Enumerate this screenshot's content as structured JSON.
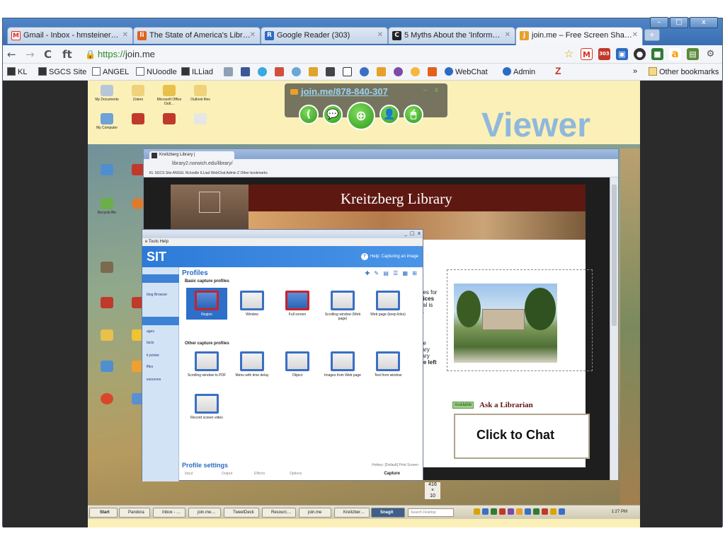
{
  "window": {
    "min": "–",
    "max": "□",
    "close": "x",
    "tabs": [
      {
        "label": "Gmail - Inbox - hmsteiner…",
        "favicon": "M",
        "color": "#d93025"
      },
      {
        "label": "The State of America's Libr…",
        "favicon": "li",
        "color": "#e0601c"
      },
      {
        "label": "Google Reader (303)",
        "favicon": "R",
        "color": "#2b6bc4"
      },
      {
        "label": "5 Myths About the 'Inform…",
        "favicon": "C",
        "color": "#222222"
      },
      {
        "label": "join.me – Free Screen Sha…",
        "favicon": "j",
        "color": "#e9a02a"
      }
    ],
    "new_tab": "+"
  },
  "toolbar": {
    "back": "←",
    "forward": "→",
    "reload": "C",
    "home": "ft",
    "url_scheme": "https://",
    "url_rest": "join.me"
  },
  "extensions": [
    {
      "name": "star-icon",
      "glyph": "☆",
      "color": "#d9a400"
    },
    {
      "name": "gmail-icon",
      "glyph": "M",
      "color": "#d93025"
    },
    {
      "name": "reader-count-icon",
      "glyph": "303",
      "color": "#c0392b"
    },
    {
      "name": "photo-icon",
      "glyph": "▣",
      "color": "#2b6bc4"
    },
    {
      "name": "circle-icon",
      "glyph": "●",
      "color": "#333333"
    },
    {
      "name": "puzzle-icon",
      "glyph": "■",
      "color": "#2e7d32"
    },
    {
      "name": "amazon-icon",
      "glyph": "a",
      "color": "#ff9900"
    },
    {
      "name": "page-icon",
      "glyph": "▤",
      "color": "#5a8a3a"
    },
    {
      "name": "wrench-icon",
      "glyph": "🔧",
      "color": "#666666"
    }
  ],
  "bookmarks": {
    "kl": "KL",
    "sgcs": "SGCS Site",
    "angel": "ANGEL",
    "nuoodle": "NUoodle",
    "illiad": "ILLiad",
    "webchat": "WebChat",
    "admin": "Admin",
    "z": "Z",
    "overflow": "»",
    "other": "Other bookmarks"
  },
  "joinme": {
    "url": "join.me/878-840-307",
    "min": "–",
    "close": "x",
    "buttons": [
      "(",
      "💬",
      "⊕",
      "👤",
      "🖱"
    ]
  },
  "viewer_label": "Viewer",
  "inner_browser": {
    "tab_label": "Kreitzberg Library |",
    "url": "library2.norwich.edu/library/",
    "bookmarks": "KL   SGCS Site   ANGEL   NUoodle   ILLiad        WebChat   Admin   Z          Other bookmarks"
  },
  "library": {
    "title": "Kreitzberg Library",
    "text_lines": [
      "oes for",
      "vices",
      "ital is",
      "s.",
      "",
      "",
      "ne",
      "rary",
      "rary",
      "he left"
    ],
    "available": "Available",
    "ask": "Ask a Librarian",
    "chat": "Click to Chat"
  },
  "snagit": {
    "winbtns": "_ □ x",
    "menu": "e   Tools   Help",
    "brand": "SIT",
    "help": "Help: Capturing an image",
    "profiles": "Profiles",
    "basic_header": "Basic capture profiles",
    "other_header": "Other capture profiles",
    "basic": [
      "Region",
      "Window",
      "Full screen",
      "Scrolling window (Web page)",
      "Web page (keep links)"
    ],
    "other": [
      "Scrolling window to PDF",
      "Menu with time delay",
      "Object",
      "Images from Web page",
      "Text from window"
    ],
    "record": "Record screen video",
    "side_items": [
      "blog Browser",
      "ages",
      "facts",
      "ti printer",
      "ffles",
      "esources"
    ],
    "settings": "Profile settings",
    "settings_right": "Hotkey: [Default] Print Screen",
    "settings_row": [
      "Input",
      "Output",
      "Effects",
      "Options"
    ],
    "capture": "Capture"
  },
  "coords": {
    "w": "416",
    "x": "×",
    "h": "10"
  },
  "desktop_labels": [
    "My Documents",
    "Zotero",
    "Microsoft Office Outl…",
    "Outlook files",
    "My Computer",
    "Adobe Reader",
    "Recycle Bin",
    "Firefox",
    "Google Chrome",
    "Adobe Acrobat"
  ],
  "taskbar": {
    "start": "Start",
    "items": [
      "Pandora",
      "Inbox - …",
      "join.me…",
      "TweetDeck",
      "Resourc…",
      "join.me",
      "Kreitzber…",
      "Snagit"
    ],
    "search": "Search Desktop",
    "time": "1:27 PM"
  }
}
